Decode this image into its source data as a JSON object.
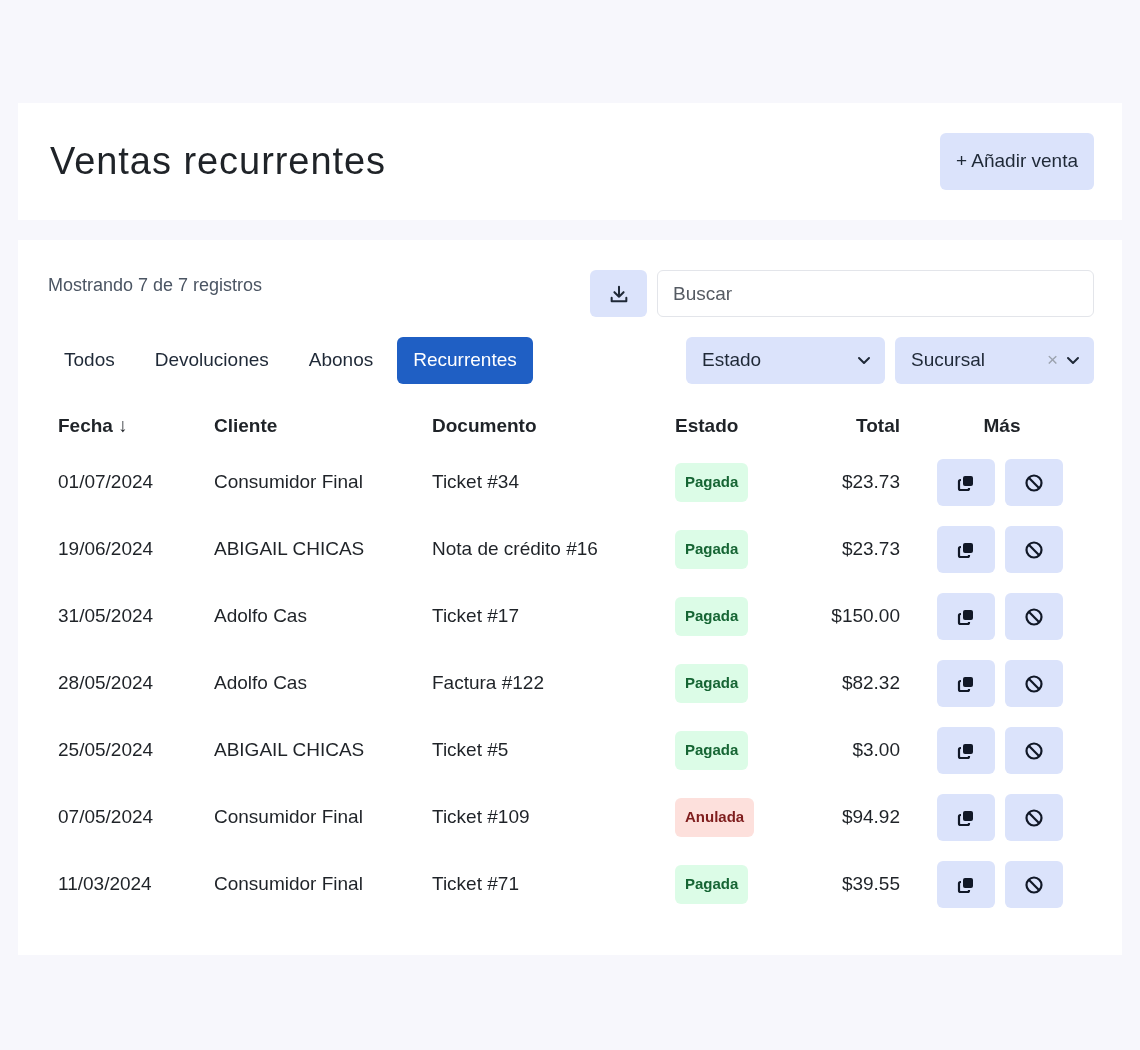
{
  "header": {
    "title": "Ventas recurrentes",
    "add_button": "+ Añadir venta"
  },
  "toolbar": {
    "record_count": "Mostrando 7 de 7 registros",
    "search": {
      "placeholder": "Buscar"
    }
  },
  "tabs": [
    {
      "label": "Todos",
      "selected": false
    },
    {
      "label": "Devoluciones",
      "selected": false
    },
    {
      "label": "Abonos",
      "selected": false
    },
    {
      "label": "Recurrentes",
      "selected": true
    }
  ],
  "filters": [
    {
      "label": "Estado"
    },
    {
      "label": "Sucursal",
      "clear": "×"
    }
  ],
  "table": {
    "columns": [
      "Fecha ↓",
      "Cliente",
      "Documento",
      "Estado",
      "Total",
      "Más"
    ],
    "rows": [
      {
        "date": "01/07/2024",
        "client": "Consumidor Final",
        "document": "Ticket #34",
        "status": "Pagada",
        "kind": "paid",
        "total": "$23.73"
      },
      {
        "date": "19/06/2024",
        "client": "ABIGAIL CHICAS",
        "document": "Nota de crédito #16",
        "status": "Pagada",
        "kind": "paid",
        "total": "$23.73"
      },
      {
        "date": "31/05/2024",
        "client": "Adolfo Cas",
        "document": "Ticket #17",
        "status": "Pagada",
        "kind": "paid",
        "total": "$150.00"
      },
      {
        "date": "28/05/2024",
        "client": "Adolfo Cas",
        "document": "Factura #122",
        "status": "Pagada",
        "kind": "paid",
        "total": "$82.32"
      },
      {
        "date": "25/05/2024",
        "client": "ABIGAIL CHICAS",
        "document": "Ticket #5",
        "status": "Pagada",
        "kind": "paid",
        "total": "$3.00"
      },
      {
        "date": "07/05/2024",
        "client": "Consumidor Final",
        "document": "Ticket #109",
        "status": "Anulada",
        "kind": "void",
        "total": "$94.92"
      },
      {
        "date": "11/03/2024",
        "client": "Consumidor Final",
        "document": "Ticket #71",
        "status": "Pagada",
        "kind": "paid",
        "total": "$39.55"
      }
    ]
  }
}
